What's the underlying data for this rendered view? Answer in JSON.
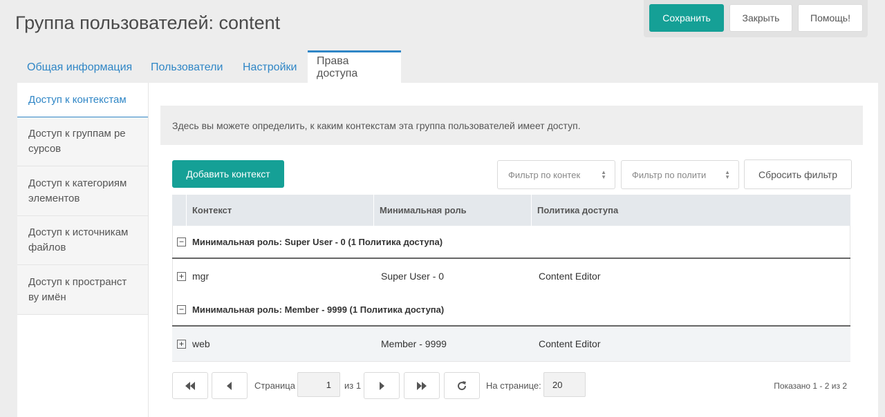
{
  "header": {
    "title": "Группа пользователей: content",
    "save_label": "Сохранить",
    "close_label": "Закрыть",
    "help_label": "Помощь!"
  },
  "tabs": [
    {
      "label": "Общая информация"
    },
    {
      "label": "Пользователи"
    },
    {
      "label": "Настройки"
    },
    {
      "label": "Права доступа",
      "active": true
    }
  ],
  "side_tabs": [
    {
      "label": "Доступ к контекстам",
      "active": true
    },
    {
      "label": "Доступ к группам ре сурсов"
    },
    {
      "label": "Доступ к категориям элементов"
    },
    {
      "label": "Доступ к источникам файлов"
    },
    {
      "label": "Доступ к пространст ву имён"
    }
  ],
  "description": "Здесь вы можете определить, к каким контекстам эта группа пользователей имеет доступ.",
  "toolbar": {
    "add_label": "Добавить контекст",
    "filter_context_placeholder": "Фильтр по контек",
    "filter_policy_placeholder": "Фильтр по полити",
    "reset_label": "Сбросить фильтр"
  },
  "grid": {
    "columns": [
      "Контекст",
      "Минимальная роль",
      "Политика доступа"
    ],
    "groups": [
      {
        "title": "Минимальная роль: Super User - 0 (1 Политика доступа)",
        "rows": [
          {
            "context": "mgr",
            "role": "Super User - 0",
            "policy": "Content Editor"
          }
        ]
      },
      {
        "title": "Минимальная роль: Member - 9999 (1 Политика доступа)",
        "rows": [
          {
            "context": "web",
            "role": "Member - 9999",
            "policy": "Content Editor"
          }
        ]
      }
    ]
  },
  "pager": {
    "page_label": "Страница",
    "page_value": "1",
    "of_label": "из 1",
    "per_page_label": "На странице:",
    "per_page_value": "20",
    "summary": "Показано 1 - 2 из 2"
  },
  "colors": {
    "primary": "#15a096",
    "link": "#2f86c6"
  }
}
